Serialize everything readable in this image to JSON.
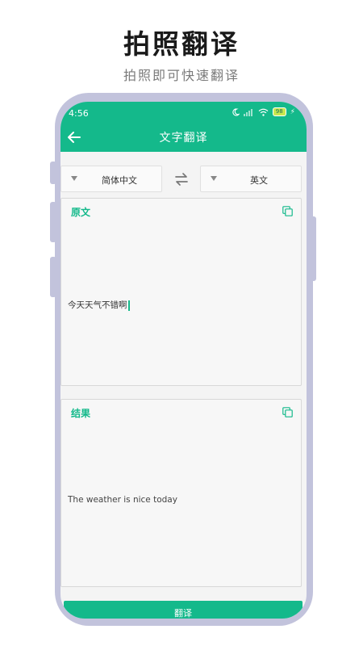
{
  "promo": {
    "title": "拍照翻译",
    "subtitle": "拍照即可快速翻译"
  },
  "status": {
    "time": "4:56",
    "battery": "98",
    "icons": [
      "moon-icon",
      "signal-icon",
      "wifi-icon",
      "battery-icon",
      "charging-icon"
    ]
  },
  "header": {
    "title": "文字翻译"
  },
  "languages": {
    "source": "简体中文",
    "target": "英文"
  },
  "source_panel": {
    "label": "原文",
    "text": "今天天气不错啊"
  },
  "result_panel": {
    "label": "结果",
    "text": "The weather is nice today"
  },
  "action": {
    "translate_label": "翻译"
  },
  "colors": {
    "accent": "#14b98b",
    "phone_frame": "#c2c3dc"
  }
}
